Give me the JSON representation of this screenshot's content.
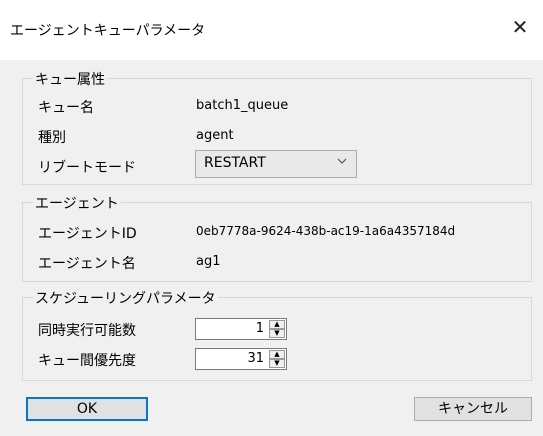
{
  "window": {
    "title": "エージェントキューパラメータ",
    "close_glyph": "✕"
  },
  "queue_attributes": {
    "group_title": "キュー属性",
    "queue_name_label": "キュー名",
    "queue_name_value": "batch1_queue",
    "type_label": "種別",
    "type_value": "agent",
    "reboot_mode_label": "リブートモード",
    "reboot_mode_value": "RESTART"
  },
  "agent": {
    "group_title": "エージェント",
    "agent_id_label": "エージェントID",
    "agent_id_value": "0eb7778a-9624-438b-ac19-1a6a4357184d",
    "agent_name_label": "エージェント名",
    "agent_name_value": "ag1"
  },
  "scheduling": {
    "group_title": "スケジューリングパラメータ",
    "concurrency_label": "同時実行可能数",
    "concurrency_value": "1",
    "priority_label": "キュー間優先度",
    "priority_value": "31"
  },
  "buttons": {
    "ok": "OK",
    "cancel": "キャンセル"
  },
  "icons": {
    "close": "close-icon",
    "dropdown": "chevron-down-icon",
    "spin_up": "triangle-up-icon",
    "spin_down": "triangle-down-icon"
  }
}
